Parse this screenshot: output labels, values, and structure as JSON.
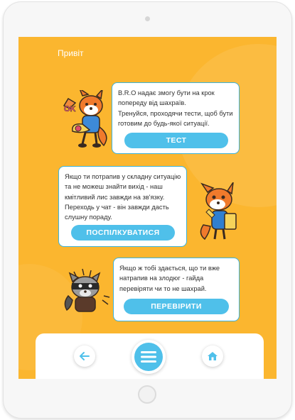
{
  "greeting": "Привіт",
  "cards": [
    {
      "text_lines": [
        "B.R.O надає змогу бути на крок",
        "попереду від шахраїв.",
        "Тренуйся, проходячи тести, щоб бути",
        "готовим до будь-якої ситуації."
      ],
      "button": "ТЕСТ",
      "sticker": "fox-ok-sticker-icon"
    },
    {
      "text_lines": [
        "Якщо ти потрапив у складну ситуацію",
        "та не можеш знайти вихід - наш",
        "кмітливий лис завжди на зв'язку.",
        "Переходь у чат - він завжди дасть",
        "слушну пораду."
      ],
      "button": "ПОСПІЛКУВАТИСЯ",
      "sticker": "fox-phone-sticker-icon"
    },
    {
      "text_lines": [
        "Якщо ж тобі здається, що ти вже",
        "натрапив на злодюг - гайда",
        "перевіряти чи то не шахрай."
      ],
      "button": "ПЕРЕВІРИТИ",
      "sticker": "raccoon-thief-sticker-icon"
    }
  ],
  "nav": {
    "back": "back-arrow-icon",
    "menu": "menu-icon",
    "home": "home-icon"
  },
  "colors": {
    "background": "#fbb62f",
    "accent": "#4fc0ea",
    "card_border": "#3ab3dd"
  }
}
